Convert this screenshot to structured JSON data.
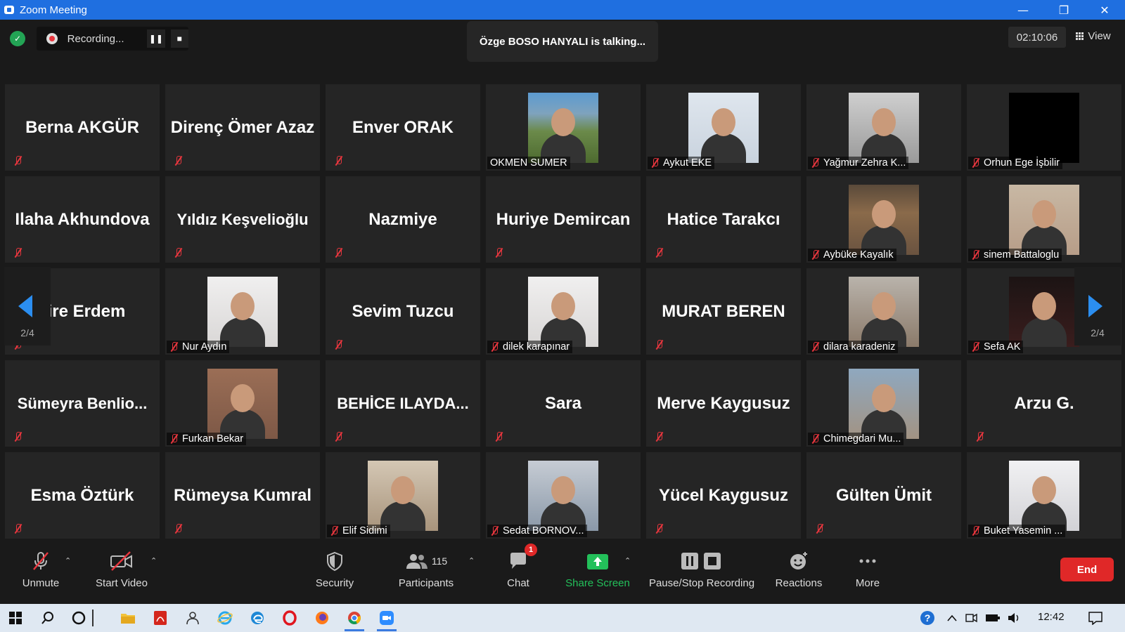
{
  "window": {
    "title": "Zoom Meeting",
    "minimize_glyph": "—",
    "restore_glyph": "❐",
    "close_glyph": "✕"
  },
  "header": {
    "recording_label": "Recording...",
    "talking_label": "Özge BOSO HANYALI is talking...",
    "timer": "02:10:06",
    "view_label": "View"
  },
  "gallery": {
    "page_label_left": "2/4",
    "page_label_right": "2/4",
    "tiles": [
      {
        "name": "Berna AKGÜR",
        "video": false
      },
      {
        "name": "Direnç Ömer Azaz",
        "video": false
      },
      {
        "name": "Enver ORAK",
        "video": false
      },
      {
        "name": "OKMEN SUMER",
        "video": true,
        "photo": "p-hill",
        "muted": false
      },
      {
        "name": "Aykut EKE",
        "video": true,
        "photo": "p-smile",
        "muted": true
      },
      {
        "name": "Yağmur Zehra K...",
        "video": true,
        "photo": "p-gray",
        "muted": true
      },
      {
        "name": "Orhun Ege İşbilir",
        "video": true,
        "photo": "p-black",
        "muted": true
      },
      {
        "name": "Ilaha Akhundova",
        "video": false
      },
      {
        "name": "Yıldız Keşvelioğlu",
        "video": false
      },
      {
        "name": "Nazmiye",
        "video": false
      },
      {
        "name": "Huriye Demircan",
        "video": false
      },
      {
        "name": "Hatice Tarakcı",
        "video": false
      },
      {
        "name": "Aybüke Kayalık",
        "video": true,
        "photo": "p-rock",
        "muted": true
      },
      {
        "name": "sinem Battaloglu",
        "video": true,
        "photo": "p-beach",
        "muted": true
      },
      {
        "name": "zire Erdem",
        "video": false
      },
      {
        "name": "Nur Aydın",
        "video": true,
        "photo": "p-room",
        "muted": true
      },
      {
        "name": "Sevim Tuzcu",
        "video": false
      },
      {
        "name": "dilek karapınar",
        "video": true,
        "photo": "p-room",
        "muted": true
      },
      {
        "name": "MURAT BEREN",
        "video": false
      },
      {
        "name": "dilara karadeniz",
        "video": true,
        "photo": "p-street",
        "muted": true
      },
      {
        "name": "Sefa AK",
        "video": true,
        "photo": "p-dark",
        "muted": true
      },
      {
        "name": "Sümeyra  Benlio...",
        "video": false
      },
      {
        "name": "Furkan Bekar",
        "video": true,
        "photo": "p-arch",
        "muted": true
      },
      {
        "name": "BEHİCE  ILAYDA...",
        "video": false
      },
      {
        "name": "Sara",
        "video": false
      },
      {
        "name": "Merve Kaygusuz",
        "video": false
      },
      {
        "name": "Chimegdari Mu...",
        "video": true,
        "photo": "p-duo",
        "muted": true
      },
      {
        "name": "Arzu G.",
        "video": false
      },
      {
        "name": "Esma Öztürk",
        "video": false
      },
      {
        "name": "Rümeysa Kumral",
        "video": false
      },
      {
        "name": "Elif Sidimi",
        "video": true,
        "photo": "p-scarf",
        "muted": true
      },
      {
        "name": "Sedat BORNOV...",
        "video": true,
        "photo": "p-man",
        "muted": true
      },
      {
        "name": "Yücel Kaygusuz",
        "video": false
      },
      {
        "name": "Gülten Ümit",
        "video": false
      },
      {
        "name": "Buket Yasemin ...",
        "video": true,
        "photo": "p-peace",
        "muted": true
      }
    ]
  },
  "toolbar": {
    "unmute": "Unmute",
    "start_video": "Start Video",
    "security": "Security",
    "participants": "Participants",
    "participants_count": "115",
    "chat": "Chat",
    "chat_badge": "1",
    "share_screen": "Share Screen",
    "pause_stop_recording": "Pause/Stop Recording",
    "reactions": "Reactions",
    "more": "More",
    "end": "End"
  },
  "taskbar": {
    "time": "12:42"
  },
  "colors": {
    "accent_blue": "#1f6fe0",
    "end_red": "#e02828",
    "share_green": "#23c05a",
    "mute_red": "#e8363e"
  }
}
